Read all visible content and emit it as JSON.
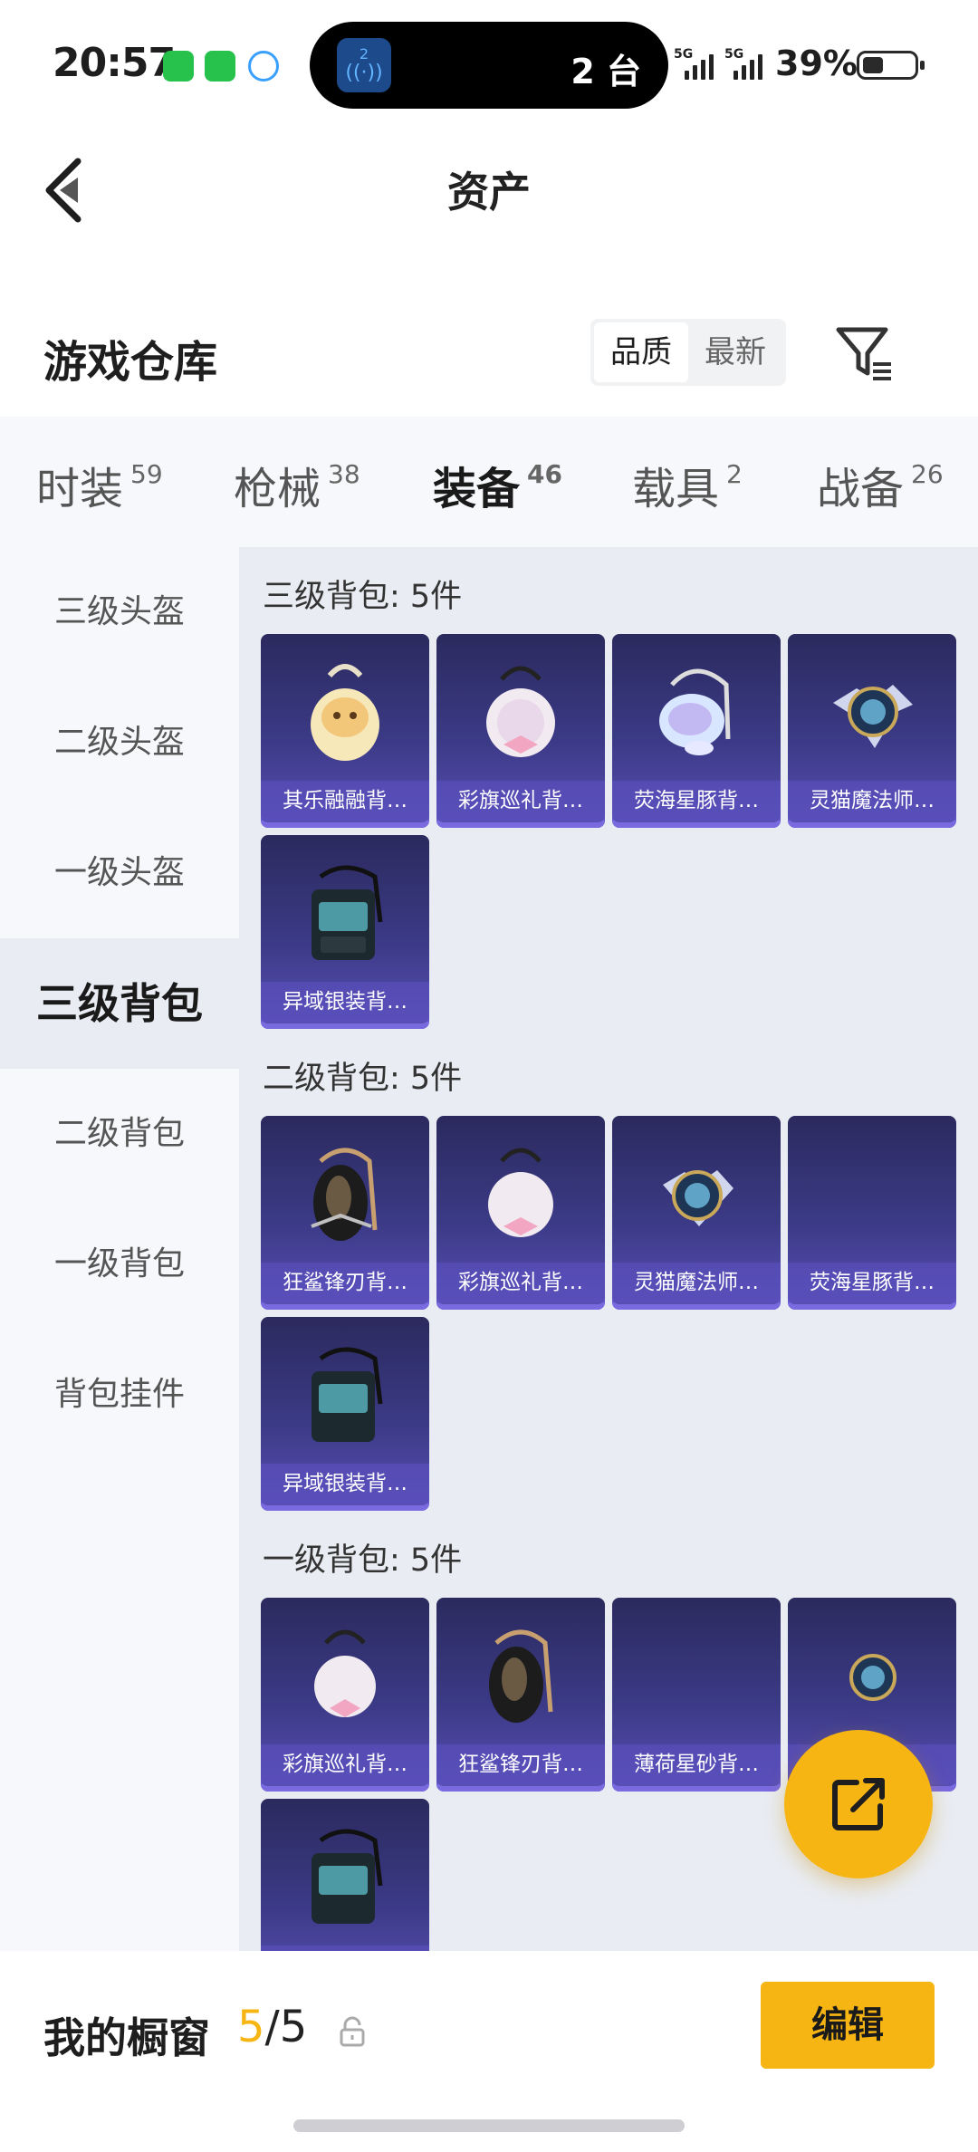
{
  "status_bar": {
    "time": "20:57",
    "island_count": "2 台",
    "cast_badge": "2",
    "network_1": "5G",
    "network_2": "5G",
    "battery": "39%"
  },
  "header": {
    "title": "资产",
    "back_icon": "chevron-left-icon"
  },
  "warehouse": {
    "title": "游戏仓库",
    "sort_options": [
      "品质",
      "最新"
    ],
    "sort_active": "品质",
    "filter_icon": "filter-icon"
  },
  "tabs": [
    {
      "label": "时装",
      "count": "59"
    },
    {
      "label": "枪械",
      "count": "38"
    },
    {
      "label": "装备",
      "count": "46"
    },
    {
      "label": "载具",
      "count": "2"
    },
    {
      "label": "战备",
      "count": "26"
    }
  ],
  "active_tab": "装备",
  "sidebar": [
    "三级头盔",
    "二级头盔",
    "一级头盔",
    "三级背包",
    "二级背包",
    "一级背包",
    "背包挂件"
  ],
  "sidebar_active": "三级背包",
  "sections": [
    {
      "title": "三级背包: 5件",
      "items": [
        "其乐融融背…",
        "彩旗巡礼背…",
        "荧海星豚背…",
        "灵猫魔法师…",
        "异域银装背…"
      ]
    },
    {
      "title": "二级背包: 5件",
      "items": [
        "狂鲨锋刃背…",
        "彩旗巡礼背…",
        "灵猫魔法师…",
        "荧海星豚背…",
        "异域银装背…"
      ]
    },
    {
      "title": "一级背包: 5件",
      "items": [
        "彩旗巡礼背…",
        "狂鲨锋刃背…",
        "薄荷星砂背…",
        "",
        ""
      ]
    }
  ],
  "share_icon": "share-icon",
  "bottom_bar": {
    "label": "我的橱窗",
    "current": "5",
    "separator": "/",
    "total": "5",
    "lock_icon": "lock-icon",
    "edit_label": "编辑"
  },
  "colors": {
    "accent": "#f7b514",
    "card_bg": "#3b3a86"
  }
}
